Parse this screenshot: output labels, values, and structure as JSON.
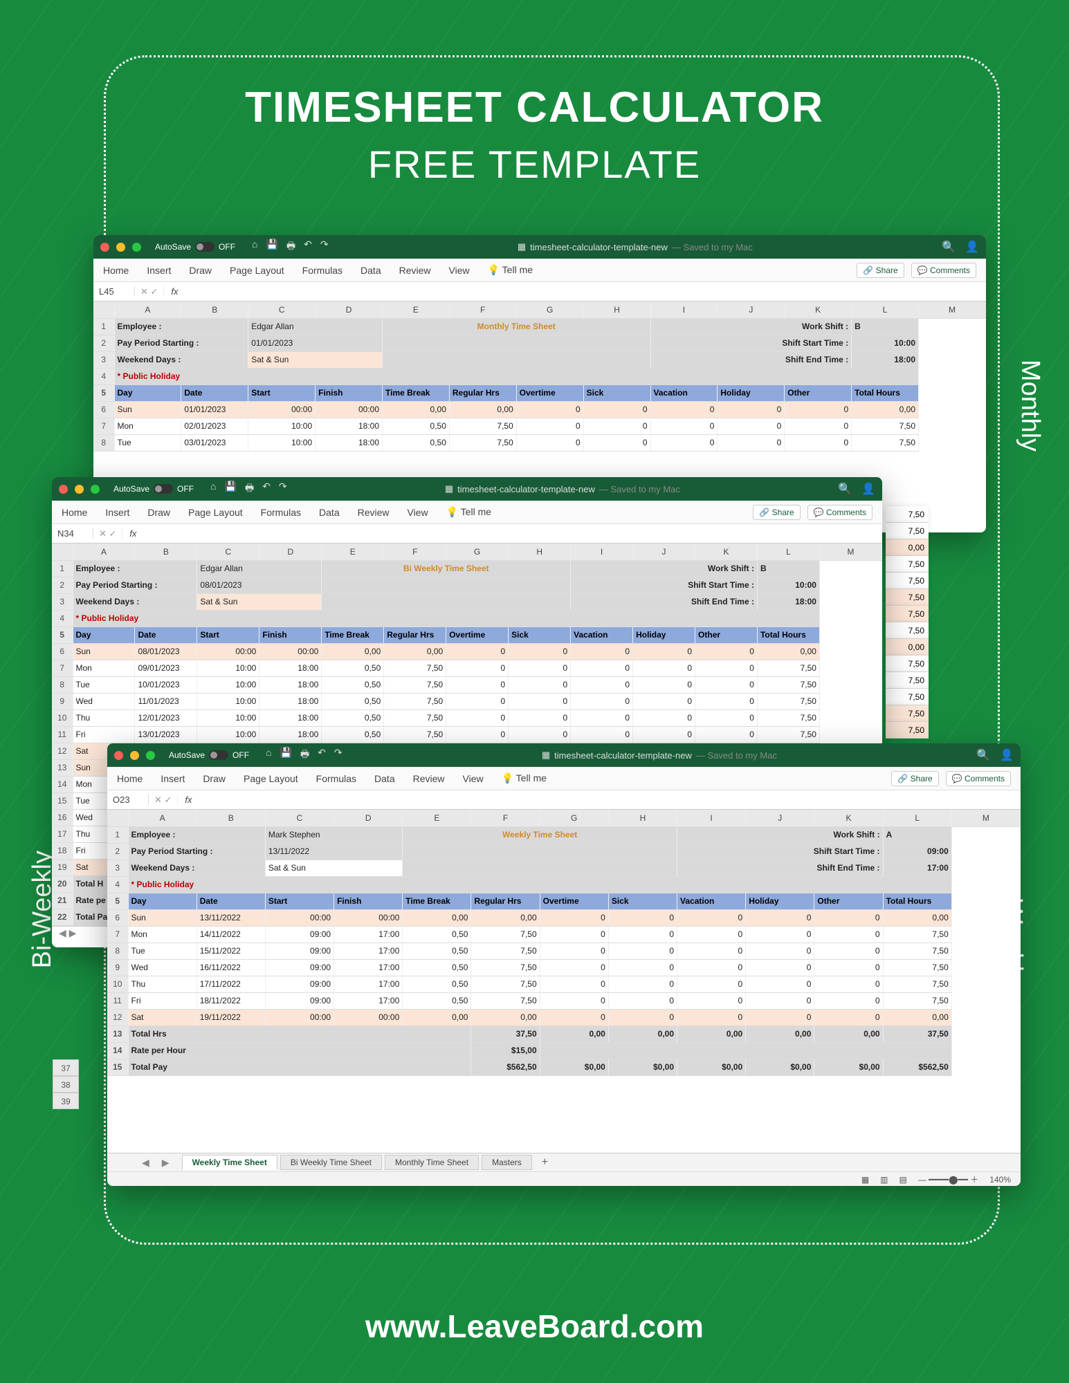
{
  "page": {
    "headline": "TIMESHEET CALCULATOR",
    "subhead": "FREE TEMPLATE",
    "site": "www.LeaveBoard.com",
    "labels": {
      "monthly": "Monthly",
      "weekly": "Weekly",
      "biweekly": "Bi-Weekly"
    }
  },
  "titlebar": {
    "autosave": "AutoSave",
    "off": "OFF",
    "docname_prefix": "timesheet-calculator-template-new",
    "saved": "— Saved to my Mac"
  },
  "ribbon": {
    "tabs": [
      "Home",
      "Insert",
      "Draw",
      "Page Layout",
      "Formulas",
      "Data",
      "Review",
      "View"
    ],
    "tellme": "Tell me",
    "share": "Share",
    "comments": "Comments"
  },
  "letters": [
    "",
    "A",
    "B",
    "C",
    "D",
    "E",
    "F",
    "G",
    "H",
    "I",
    "J",
    "K",
    "L",
    "M"
  ],
  "columns": [
    "Day",
    "Date",
    "Start",
    "Finish",
    "Time Break",
    "Regular Hrs",
    "Overtime",
    "Sick",
    "Vacation",
    "Holiday",
    "Other",
    "Total Hours"
  ],
  "meta_labels": {
    "employee": "Employee :",
    "period": "Pay Period Starting :",
    "weekend": "Weekend Days :",
    "holiday": "* Public Holiday",
    "shift": "Work Shift :",
    "start": "Shift Start Time :",
    "end": "Shift End Time :"
  },
  "totals_labels": {
    "hrs": "Total  Hrs",
    "rate": "Rate per Hour",
    "pay": "Total Pay"
  },
  "sheets_tabs": [
    "Weekly Time Sheet",
    "Bi Weekly Time Sheet",
    "Monthly Time Sheet",
    "Masters"
  ],
  "monthly": {
    "cell": "L45",
    "title": "Monthly Time Sheet",
    "employee": "Edgar Allan",
    "period": "01/01/2023",
    "weekend": "Sat & Sun",
    "shift": "B",
    "start": "10:00",
    "end": "18:00",
    "rows": [
      {
        "r": 6,
        "day": "Sun",
        "date": "01/01/2023",
        "start": "00:00",
        "finish": "00:00",
        "break": "0,00",
        "reg": "0,00",
        "ot": "0",
        "sick": "0",
        "vac": "0",
        "hol": "0",
        "oth": "0",
        "tot": "0,00",
        "wk": true
      },
      {
        "r": 7,
        "day": "Mon",
        "date": "02/01/2023",
        "start": "10:00",
        "finish": "18:00",
        "break": "0,50",
        "reg": "7,50",
        "ot": "0",
        "sick": "0",
        "vac": "0",
        "hol": "0",
        "oth": "0",
        "tot": "7,50"
      },
      {
        "r": 8,
        "day": "Tue",
        "date": "03/01/2023",
        "start": "10:00",
        "finish": "18:00",
        "break": "0,50",
        "reg": "7,50",
        "ot": "0",
        "sick": "0",
        "vac": "0",
        "hol": "0",
        "oth": "0",
        "tot": "7,50"
      }
    ],
    "side_totals": [
      "7,50",
      "7,50",
      "0,00",
      "7,50",
      "7,50",
      "7,50",
      "7,50",
      "7,50",
      "0,00",
      "7,50",
      "7,50",
      "7,50",
      "7,50",
      "7,50"
    ]
  },
  "biweekly": {
    "cell": "N34",
    "title": "Bi Weekly Time Sheet",
    "employee": "Edgar Allan",
    "period": "08/01/2023",
    "weekend": "Sat & Sun",
    "shift": "B",
    "start": "10:00",
    "end": "18:00",
    "rows": [
      {
        "r": 6,
        "day": "Sun",
        "date": "08/01/2023",
        "start": "00:00",
        "finish": "00:00",
        "break": "0,00",
        "reg": "0,00",
        "ot": "0",
        "sick": "0",
        "vac": "0",
        "hol": "0",
        "oth": "0",
        "tot": "0,00",
        "wk": true
      },
      {
        "r": 7,
        "day": "Mon",
        "date": "09/01/2023",
        "start": "10:00",
        "finish": "18:00",
        "break": "0,50",
        "reg": "7,50",
        "ot": "0",
        "sick": "0",
        "vac": "0",
        "hol": "0",
        "oth": "0",
        "tot": "7,50"
      },
      {
        "r": 8,
        "day": "Tue",
        "date": "10/01/2023",
        "start": "10:00",
        "finish": "18:00",
        "break": "0,50",
        "reg": "7,50",
        "ot": "0",
        "sick": "0",
        "vac": "0",
        "hol": "0",
        "oth": "0",
        "tot": "7,50"
      },
      {
        "r": 9,
        "day": "Wed",
        "date": "11/01/2023",
        "start": "10:00",
        "finish": "18:00",
        "break": "0,50",
        "reg": "7,50",
        "ot": "0",
        "sick": "0",
        "vac": "0",
        "hol": "0",
        "oth": "0",
        "tot": "7,50"
      },
      {
        "r": 10,
        "day": "Thu",
        "date": "12/01/2023",
        "start": "10:00",
        "finish": "18:00",
        "break": "0,50",
        "reg": "7,50",
        "ot": "0",
        "sick": "0",
        "vac": "0",
        "hol": "0",
        "oth": "0",
        "tot": "7,50"
      },
      {
        "r": 11,
        "day": "Fri",
        "date": "13/01/2023",
        "start": "10:00",
        "finish": "18:00",
        "break": "0,50",
        "reg": "7,50",
        "ot": "0",
        "sick": "0",
        "vac": "0",
        "hol": "0",
        "oth": "0",
        "tot": "7,50"
      },
      {
        "r": 12,
        "day": "Sat",
        "date": "",
        "start": "",
        "finish": "",
        "break": "",
        "reg": "",
        "ot": "",
        "sick": "",
        "vac": "",
        "hol": "",
        "oth": "",
        "tot": "",
        "wk": true
      },
      {
        "r": 13,
        "day": "Sun",
        "date": "",
        "start": "",
        "finish": "",
        "break": "",
        "reg": "",
        "ot": "",
        "sick": "",
        "vac": "",
        "hol": "",
        "oth": "",
        "tot": "",
        "wk": true
      },
      {
        "r": 14,
        "day": "Mon",
        "date": "",
        "start": "",
        "finish": "",
        "break": "",
        "reg": "",
        "ot": "",
        "sick": "",
        "vac": "",
        "hol": "",
        "oth": "",
        "tot": ""
      },
      {
        "r": 15,
        "day": "Tue",
        "date": "",
        "start": "",
        "finish": "",
        "break": "",
        "reg": "",
        "ot": "",
        "sick": "",
        "vac": "",
        "hol": "",
        "oth": "",
        "tot": ""
      },
      {
        "r": 16,
        "day": "Wed",
        "date": "",
        "start": "",
        "finish": "",
        "break": "",
        "reg": "",
        "ot": "",
        "sick": "",
        "vac": "",
        "hol": "",
        "oth": "",
        "tot": ""
      },
      {
        "r": 17,
        "day": "Thu",
        "date": "",
        "start": "",
        "finish": "",
        "break": "",
        "reg": "",
        "ot": "",
        "sick": "",
        "vac": "",
        "hol": "",
        "oth": "",
        "tot": ""
      },
      {
        "r": 18,
        "day": "Fri",
        "date": "",
        "start": "",
        "finish": "",
        "break": "",
        "reg": "",
        "ot": "",
        "sick": "",
        "vac": "",
        "hol": "",
        "oth": "",
        "tot": ""
      },
      {
        "r": 19,
        "day": "Sat",
        "date": "",
        "start": "",
        "finish": "",
        "break": "",
        "reg": "",
        "ot": "",
        "sick": "",
        "vac": "",
        "hol": "",
        "oth": "",
        "tot": "",
        "wk": true
      }
    ],
    "totals_rows": [
      {
        "r": 20,
        "label": "Total  H"
      },
      {
        "r": 21,
        "label": "Rate pe"
      },
      {
        "r": 22,
        "label": "Total Pa"
      }
    ]
  },
  "weekly": {
    "cell": "O23",
    "title": "Weekly Time Sheet",
    "employee": "Mark Stephen",
    "period": "13/11/2022",
    "weekend": "Sat & Sun",
    "shift": "A",
    "start": "09:00",
    "end": "17:00",
    "rows": [
      {
        "r": 6,
        "day": "Sun",
        "date": "13/11/2022",
        "start": "00:00",
        "finish": "00:00",
        "break": "0,00",
        "reg": "0,00",
        "ot": "0",
        "sick": "0",
        "vac": "0",
        "hol": "0",
        "oth": "0",
        "tot": "0,00",
        "wk": true
      },
      {
        "r": 7,
        "day": "Mon",
        "date": "14/11/2022",
        "start": "09:00",
        "finish": "17:00",
        "break": "0,50",
        "reg": "7,50",
        "ot": "0",
        "sick": "0",
        "vac": "0",
        "hol": "0",
        "oth": "0",
        "tot": "7,50"
      },
      {
        "r": 8,
        "day": "Tue",
        "date": "15/11/2022",
        "start": "09:00",
        "finish": "17:00",
        "break": "0,50",
        "reg": "7,50",
        "ot": "0",
        "sick": "0",
        "vac": "0",
        "hol": "0",
        "oth": "0",
        "tot": "7,50"
      },
      {
        "r": 9,
        "day": "Wed",
        "date": "16/11/2022",
        "start": "09:00",
        "finish": "17:00",
        "break": "0,50",
        "reg": "7,50",
        "ot": "0",
        "sick": "0",
        "vac": "0",
        "hol": "0",
        "oth": "0",
        "tot": "7,50"
      },
      {
        "r": 10,
        "day": "Thu",
        "date": "17/11/2022",
        "start": "09:00",
        "finish": "17:00",
        "break": "0,50",
        "reg": "7,50",
        "ot": "0",
        "sick": "0",
        "vac": "0",
        "hol": "0",
        "oth": "0",
        "tot": "7,50"
      },
      {
        "r": 11,
        "day": "Fri",
        "date": "18/11/2022",
        "start": "09:00",
        "finish": "17:00",
        "break": "0,50",
        "reg": "7,50",
        "ot": "0",
        "sick": "0",
        "vac": "0",
        "hol": "0",
        "oth": "0",
        "tot": "7,50"
      },
      {
        "r": 12,
        "day": "Sat",
        "date": "19/11/2022",
        "start": "00:00",
        "finish": "00:00",
        "break": "0,00",
        "reg": "0,00",
        "ot": "0",
        "sick": "0",
        "vac": "0",
        "hol": "0",
        "oth": "0",
        "tot": "0,00",
        "wk": true
      }
    ],
    "total_hrs": {
      "reg": "37,50",
      "ot": "0,00",
      "sick": "0,00",
      "vac": "0,00",
      "hol": "0,00",
      "oth": "0,00",
      "tot": "37,50"
    },
    "rate": "$15,00",
    "total_pay": {
      "reg": "$562,50",
      "ot": "$0,00",
      "sick": "$0,00",
      "vac": "$0,00",
      "hol": "$0,00",
      "oth": "$0,00",
      "tot": "$562,50"
    },
    "zoom": "140%",
    "side_nums": [
      "37",
      "38",
      "39"
    ]
  }
}
